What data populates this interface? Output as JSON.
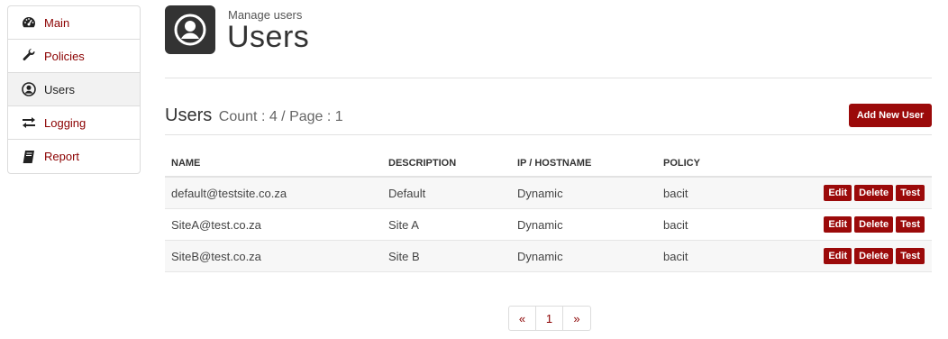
{
  "sidebar": {
    "items": [
      {
        "label": "Main",
        "icon": "dashboard-icon",
        "active": false
      },
      {
        "label": "Policies",
        "icon": "wrench-icon",
        "active": false
      },
      {
        "label": "Users",
        "icon": "user-circle-icon",
        "active": true
      },
      {
        "label": "Logging",
        "icon": "exchange-icon",
        "active": false
      },
      {
        "label": "Report",
        "icon": "book-icon",
        "active": false
      }
    ]
  },
  "header": {
    "subtitle": "Manage users",
    "title": "Users",
    "icon": "user-circle-icon"
  },
  "section": {
    "title": "Users",
    "meta": "Count : 4 / Page : 1",
    "add_button": "Add New User"
  },
  "table": {
    "columns": [
      "NAME",
      "DESCRIPTION",
      "IP / HOSTNAME",
      "POLICY"
    ],
    "rows": [
      {
        "name": "default@testsite.co.za",
        "description": "Default",
        "ip": "Dynamic",
        "policy": "bacit"
      },
      {
        "name": "SiteA@test.co.za",
        "description": "Site A",
        "ip": "Dynamic",
        "policy": "bacit"
      },
      {
        "name": "SiteB@test.co.za",
        "description": "Site B",
        "ip": "Dynamic",
        "policy": "bacit"
      }
    ],
    "actions": {
      "edit": "Edit",
      "delete": "Delete",
      "test": "Test"
    }
  },
  "pagination": {
    "prev": "«",
    "current": "1",
    "next": "»"
  },
  "colors": {
    "accent": "#9b0a0a",
    "link": "#8b0000",
    "header_icon_bg": "#333333"
  }
}
